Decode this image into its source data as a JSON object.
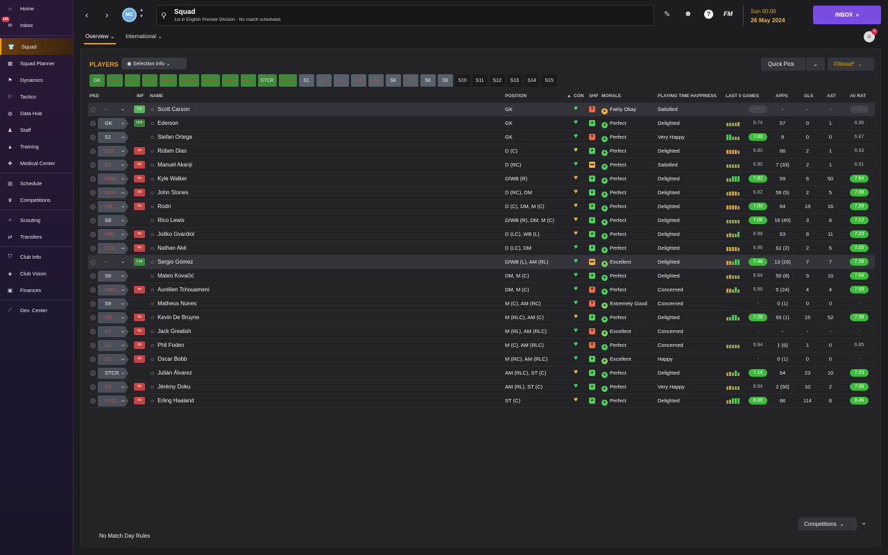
{
  "sidebar": {
    "items": [
      {
        "label": "Home",
        "icon": "home-icon"
      },
      {
        "label": "Inbox",
        "icon": "inbox-icon",
        "badge": "150"
      },
      {
        "label": "Squad",
        "icon": "shirt-icon",
        "active": true
      },
      {
        "label": "Squad Planner",
        "icon": "planner-icon"
      },
      {
        "label": "Dynamics",
        "icon": "dynamics-icon"
      },
      {
        "label": "Tactics",
        "icon": "tactics-icon"
      },
      {
        "label": "Data Hub",
        "icon": "datahub-icon"
      },
      {
        "label": "Staff",
        "icon": "staff-icon"
      },
      {
        "label": "Training",
        "icon": "training-icon"
      },
      {
        "label": "Medical Center",
        "icon": "medical-icon"
      },
      {
        "label": "Schedule",
        "icon": "calendar-icon"
      },
      {
        "label": "Competitions",
        "icon": "trophy-icon"
      },
      {
        "label": "Scouting",
        "icon": "scouting-icon"
      },
      {
        "label": "Transfers",
        "icon": "transfers-icon"
      },
      {
        "label": "Club Info",
        "icon": "shield-icon"
      },
      {
        "label": "Club Vision",
        "icon": "vision-icon"
      },
      {
        "label": "Finances",
        "icon": "finances-icon"
      },
      {
        "label": "Dev. Center",
        "icon": "devcenter-icon"
      }
    ]
  },
  "header": {
    "title": "Squad",
    "subtitle": "1st in English Premier Division - No match scheduled.",
    "crest": "MC",
    "day": "Sun 00:00",
    "date": "26 May 2024",
    "inbox": "INBOX",
    "fm": "FM",
    "help": "?"
  },
  "subnav": {
    "overview": "Overview",
    "international": "International",
    "avatar_badge": "6"
  },
  "toolbar": {
    "players": "PLAYERS",
    "selection_info": "Selection Info",
    "quick_pick": "Quick Pick",
    "filtered": "Filtered*"
  },
  "positions": [
    {
      "label": "GK",
      "style": "g"
    },
    {
      "label": "DCR",
      "style": "go"
    },
    {
      "label": "DC",
      "style": "go"
    },
    {
      "label": "DCL",
      "style": "go"
    },
    {
      "label": "WBR",
      "style": "go"
    },
    {
      "label": "DMCR",
      "style": "go"
    },
    {
      "label": "DMCL",
      "style": "go"
    },
    {
      "label": "WBL",
      "style": "go"
    },
    {
      "label": "MC",
      "style": "go"
    },
    {
      "label": "STCR",
      "style": "g"
    },
    {
      "label": "STCL",
      "style": "go"
    },
    {
      "label": "S1",
      "style": "s"
    },
    {
      "label": "S2",
      "style": "so"
    },
    {
      "label": "S3",
      "style": "so"
    },
    {
      "label": "S4",
      "style": "so"
    },
    {
      "label": "S5",
      "style": "so"
    },
    {
      "label": "S6",
      "style": "s"
    },
    {
      "label": "S7",
      "style": "so"
    },
    {
      "label": "S8",
      "style": "s"
    },
    {
      "label": "S9",
      "style": "s"
    },
    {
      "label": "S10",
      "style": "d"
    },
    {
      "label": "S11",
      "style": "d"
    },
    {
      "label": "S12",
      "style": "d"
    },
    {
      "label": "S13",
      "style": "d"
    },
    {
      "label": "S14",
      "style": "d"
    },
    {
      "label": "S15",
      "style": "d"
    }
  ],
  "columns": {
    "pkd": "PKD",
    "inf": "INF",
    "name": "NAME",
    "position": "POSITION",
    "con": "CON",
    "shp": "SHP",
    "morale": "MORALE",
    "pth": "PLAYING TIME HAPPINESS",
    "last5": "LAST 5 GAMES",
    "apps": "APPS",
    "gls": "GLS",
    "ast": "AST",
    "avrat": "AV RAT"
  },
  "players": [
    {
      "pkd": "-",
      "pkd_style": "none",
      "inf": "Lst",
      "inf_style": "lst",
      "name": "Scott Carson",
      "position": "GK",
      "con": "#3fe060",
      "shp": "dn",
      "morale": "Fairly Okay",
      "morale_color": "#f1b23e",
      "pth": "Satisfied",
      "form": "",
      "last": "-",
      "last_style": "dash",
      "apps": "-",
      "gls": "-",
      "ast": "-",
      "avr": "-",
      "avr_style": "dash",
      "hl": true
    },
    {
      "pkd": "GK",
      "pkd_style": "white",
      "inf": "Unh",
      "inf_style": "unh",
      "name": "Ederson",
      "position": "GK",
      "con": "#3fe060",
      "shp": "up",
      "morale": "Perfect",
      "morale_color": "#4bd15a",
      "pth": "Delighted",
      "form": "ggggy",
      "last": "6.74",
      "last_style": "",
      "apps": "57",
      "gls": "0",
      "ast": "1",
      "avr": "6.95",
      "avr_style": ""
    },
    {
      "pkd": "S1",
      "pkd_style": "white",
      "inf": "",
      "inf_style": "",
      "name": "Stefan Ortega",
      "position": "GK",
      "con": "#3fe060",
      "shp": "dn",
      "morale": "Perfect",
      "morale_color": "#4bd15a",
      "pth": "Very Happy",
      "form": "GGggg",
      "last": "7.00",
      "last_style": "hi",
      "apps": "9",
      "gls": "0",
      "ast": "0",
      "avr": "6.87",
      "avr_style": ""
    },
    {
      "pkd": "DCL",
      "pkd_style": "red",
      "inf": "Int",
      "inf_style": "int",
      "name": "Rúben Dias",
      "position": "D (C)",
      "con": "#b6e040",
      "shp": "up",
      "morale": "Perfect",
      "morale_color": "#4bd15a",
      "pth": "Delighted",
      "form": "yyyyg",
      "last": "6.80",
      "last_style": "",
      "apps": "66",
      "gls": "2",
      "ast": "1",
      "avr": "6.93",
      "avr_style": ""
    },
    {
      "pkd": "S2",
      "pkd_style": "red",
      "inf": "Int",
      "inf_style": "int",
      "name": "Manuel Akanji",
      "position": "D (RC)",
      "con": "#3fe060",
      "shp": "mid",
      "morale": "Perfect",
      "morale_color": "#4bd15a",
      "pth": "Satisfied",
      "form": "ggggg",
      "last": "6.90",
      "last_style": "",
      "apps": "7 (33)",
      "gls": "2",
      "ast": "1",
      "avr": "6.91",
      "avr_style": ""
    },
    {
      "pkd": "WBR",
      "pkd_style": "red",
      "inf": "Int",
      "inf_style": "int",
      "name": "Kyle Walker",
      "position": "D/WB (R)",
      "con": "#e0b040",
      "shp": "up",
      "morale": "Perfect",
      "morale_color": "#4bd15a",
      "pth": "Delighted",
      "form": "ggGGG",
      "last": "7.82",
      "last_style": "hi",
      "apps": "59",
      "gls": "6",
      "ast": "50",
      "avr": "7.94",
      "avr_style": "hi"
    },
    {
      "pkd": "DCR",
      "pkd_style": "red",
      "inf": "Int",
      "inf_style": "int",
      "name": "John Stones",
      "position": "D (RC), DM",
      "con": "#e0b040",
      "shp": "up",
      "morale": "Perfect",
      "morale_color": "#4bd15a",
      "pth": "Delighted",
      "form": "gyyyg",
      "last": "6.82",
      "last_style": "",
      "apps": "58 (5)",
      "gls": "2",
      "ast": "5",
      "avr": "7.08",
      "avr_style": "hi"
    },
    {
      "pkd": "DM...",
      "pkd_style": "red",
      "inf": "Int",
      "inf_style": "int",
      "name": "Rodri",
      "position": "D (C), DM, M (C)",
      "con": "#e0b040",
      "shp": "up",
      "morale": "Perfect",
      "morale_color": "#4bd15a",
      "pth": "Delighted",
      "form": "yyyyg",
      "last": "7.00",
      "last_style": "hi",
      "apps": "64",
      "gls": "19",
      "ast": "16",
      "avr": "7.28",
      "avr_style": "hi"
    },
    {
      "pkd": "S8",
      "pkd_style": "white",
      "inf": "",
      "inf_style": "",
      "name": "Rico Lewis",
      "position": "D/WB (R), DM, M (C)",
      "con": "#e0c040",
      "shp": "up",
      "morale": "Perfect",
      "morale_color": "#4bd15a",
      "pth": "Delighted",
      "form": "ggggg",
      "last": "7.06",
      "last_style": "hi",
      "apps": "16 (40)",
      "gls": "3",
      "ast": "8",
      "avr": "7.12",
      "avr_style": "hi"
    },
    {
      "pkd": "WBL",
      "pkd_style": "red",
      "inf": "Int",
      "inf_style": "int",
      "name": "Joško Gvardiol",
      "position": "D (LC), WB (L)",
      "con": "#e0b040",
      "shp": "up",
      "morale": "Perfect",
      "morale_color": "#4bd15a",
      "pth": "Delighted",
      "form": "gyggG",
      "last": "6.98",
      "last_style": "",
      "apps": "63",
      "gls": "8",
      "ast": "11",
      "avr": "7.23",
      "avr_style": "hi"
    },
    {
      "pkd": "DCL",
      "pkd_style": "red",
      "inf": "Int",
      "inf_style": "int",
      "name": "Nathan Aké",
      "position": "D (LC), DM",
      "con": "#3fe060",
      "shp": "up",
      "morale": "Perfect",
      "morale_color": "#4bd15a",
      "pth": "Delighted",
      "form": "yyyyg",
      "last": "6.96",
      "last_style": "",
      "apps": "61 (2)",
      "gls": "2",
      "ast": "6",
      "avr": "7.05",
      "avr_style": "hi"
    },
    {
      "pkd": "-",
      "pkd_style": "none",
      "inf": "Loa",
      "inf_style": "loa",
      "name": "Sergio Gómez",
      "position": "D/WB (L), AM (RL)",
      "con": "#3fe060",
      "shp": "mid",
      "morale": "Excellent",
      "morale_color": "#7cd15a",
      "pth": "Delighted",
      "form": "yygGG",
      "last": "7.48",
      "last_style": "hi",
      "apps": "13 (26)",
      "gls": "7",
      "ast": "7",
      "avr": "7.28",
      "avr_style": "hi",
      "hl": true
    },
    {
      "pkd": "S6",
      "pkd_style": "white",
      "inf": "",
      "inf_style": "",
      "name": "Mateo Kovačić",
      "position": "DM, M (C)",
      "con": "#3fe060",
      "shp": "up",
      "morale": "Perfect",
      "morale_color": "#4bd15a",
      "pth": "Delighted",
      "form": "gyggg",
      "last": "6.64",
      "last_style": "",
      "apps": "50 (8)",
      "gls": "9",
      "ast": "10",
      "avr": "7.04",
      "avr_style": "hi"
    },
    {
      "pkd": "DMCL",
      "pkd_style": "red",
      "inf": "Int",
      "inf_style": "int",
      "name": "Aurélien Tchouameni",
      "position": "DM, M (C)",
      "con": "#3fe060",
      "shp": "dn",
      "morale": "Perfect",
      "morale_color": "#4bd15a",
      "pth": "Concerned",
      "form": "yygGg",
      "last": "6.96",
      "last_style": "",
      "apps": "5 (24)",
      "gls": "4",
      "ast": "4",
      "avr": "7.09",
      "avr_style": "hi"
    },
    {
      "pkd": "S9",
      "pkd_style": "white",
      "inf": "",
      "inf_style": "",
      "name": "Matheus Nunes",
      "position": "M (C), AM (RC)",
      "con": "#3fe060",
      "shp": "dn",
      "morale": "Extremely Good",
      "morale_color": "#7cd15a",
      "pth": "Concerned",
      "form": "",
      "last": "-",
      "last_style": "",
      "apps": "0 (1)",
      "gls": "0",
      "ast": "0",
      "avr": "-",
      "avr_style": ""
    },
    {
      "pkd": "MC",
      "pkd_style": "red",
      "inf": "Int",
      "inf_style": "int",
      "name": "Kevin De Bruyne",
      "position": "M (RLC), AM (C)",
      "con": "#e0b040",
      "shp": "up",
      "morale": "Perfect",
      "morale_color": "#4bd15a",
      "pth": "Delighted",
      "form": "ggGGg",
      "last": "7.28",
      "last_style": "hi",
      "apps": "65 (1)",
      "gls": "15",
      "ast": "52",
      "avr": "7.38",
      "avr_style": "hi"
    },
    {
      "pkd": "S7",
      "pkd_style": "red",
      "inf": "Int",
      "inf_style": "int",
      "name": "Jack Grealish",
      "position": "M (RL), AM (RLC)",
      "con": "#3fe060",
      "shp": "dn",
      "morale": "Excellent",
      "morale_color": "#7cd15a",
      "pth": "Concerned",
      "form": "",
      "last": "-",
      "last_style": "",
      "apps": "-",
      "gls": "-",
      "ast": "-",
      "avr": "-",
      "avr_style": ""
    },
    {
      "pkd": "S3",
      "pkd_style": "red",
      "inf": "Int",
      "inf_style": "int",
      "name": "Phil Foden",
      "position": "M (C), AM (RLC)",
      "con": "#3fe060",
      "shp": "dn",
      "morale": "Perfect",
      "morale_color": "#4bd15a",
      "pth": "Concerned",
      "form": "ggggg",
      "last": "6.94",
      "last_style": "",
      "apps": "1 (6)",
      "gls": "1",
      "ast": "0",
      "avr": "6.85",
      "avr_style": ""
    },
    {
      "pkd": "S5",
      "pkd_style": "red",
      "inf": "Int",
      "inf_style": "int",
      "name": "Oscar Bobb",
      "position": "M (RC), AM (RLC)",
      "con": "#3fe060",
      "shp": "up",
      "morale": "Excellent",
      "morale_color": "#7cd15a",
      "pth": "Happy",
      "form": "",
      "last": "-",
      "last_style": "",
      "apps": "0 (1)",
      "gls": "0",
      "ast": "0",
      "avr": "-",
      "avr_style": ""
    },
    {
      "pkd": "STCR",
      "pkd_style": "white",
      "inf": "",
      "inf_style": "",
      "name": "Julián Álvarez",
      "position": "AM (RLC), ST (C)",
      "con": "#e0c040",
      "shp": "up",
      "morale": "Perfect",
      "morale_color": "#4bd15a",
      "pth": "Delighted",
      "form": "gygGg",
      "last": "7.14",
      "last_style": "hi",
      "apps": "64",
      "gls": "23",
      "ast": "10",
      "avr": "7.23",
      "avr_style": "hi"
    },
    {
      "pkd": "S4",
      "pkd_style": "red",
      "inf": "Int",
      "inf_style": "int",
      "name": "Jérémy Doku",
      "position": "AM (RL), ST (C)",
      "con": "#3fe060",
      "shp": "up",
      "morale": "Perfect",
      "morale_color": "#4bd15a",
      "pth": "Very Happy",
      "form": "gyggg",
      "last": "6.94",
      "last_style": "",
      "apps": "2 (50)",
      "gls": "10",
      "ast": "2",
      "avr": "7.08",
      "avr_style": "hi"
    },
    {
      "pkd": "STCL",
      "pkd_style": "red",
      "inf": "Int",
      "inf_style": "int",
      "name": "Erling Haaland",
      "position": "ST (C)",
      "con": "#e0c040",
      "shp": "up",
      "morale": "Perfect",
      "morale_color": "#4bd15a",
      "pth": "Delighted",
      "form": "gyGGG",
      "last": "8.06",
      "last_style": "hi",
      "apps": "66",
      "gls": "114",
      "ast": "8",
      "avr": "8.46",
      "avr_style": "hi"
    }
  ],
  "footer": {
    "rules": "No Match Day Rules",
    "competitions": "Competitions"
  },
  "colors": {
    "accent": "#f0a000",
    "inbox": "#7a4ce0",
    "good": "#3dbb3a",
    "bad": "#c34444"
  }
}
